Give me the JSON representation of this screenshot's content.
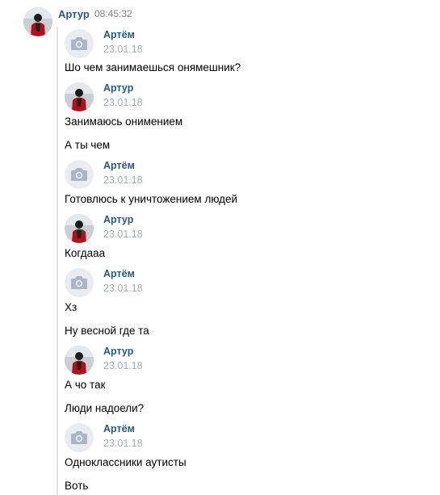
{
  "header": {
    "name": "Артур",
    "time": "08:45:32"
  },
  "messages": [
    {
      "author": "Артём",
      "date": "23.01.18",
      "avatar": "camera-icon",
      "texts": [
        "Шо чем занимаешься онямешник?"
      ]
    },
    {
      "author": "Артур",
      "date": "23.01.18",
      "avatar": "user-photo",
      "texts": [
        "Занимаюсь онимением",
        "А ты чем"
      ]
    },
    {
      "author": "Артём",
      "date": "23.01.18",
      "avatar": "camera-icon",
      "texts": [
        "Готовлюсь к уничтожением людей"
      ]
    },
    {
      "author": "Артур",
      "date": "23.01.18",
      "avatar": "user-photo",
      "texts": [
        "Когдааа"
      ]
    },
    {
      "author": "Артём",
      "date": "23.01.18",
      "avatar": "camera-icon",
      "texts": [
        "Хз",
        "Ну весной где та"
      ]
    },
    {
      "author": "Артур",
      "date": "23.01.18",
      "avatar": "user-photo",
      "texts": [
        "А чо так",
        "Люди надоели?"
      ]
    },
    {
      "author": "Артём",
      "date": "23.01.18",
      "avatar": "camera-icon",
      "texts": [
        "Одноклассники аутисты",
        "Воть"
      ]
    }
  ],
  "colors": {
    "link": "#2a5885",
    "meta": "#a7aaae",
    "camera_bg": "#e9edf2",
    "camera_fg": "#aab6c4"
  }
}
